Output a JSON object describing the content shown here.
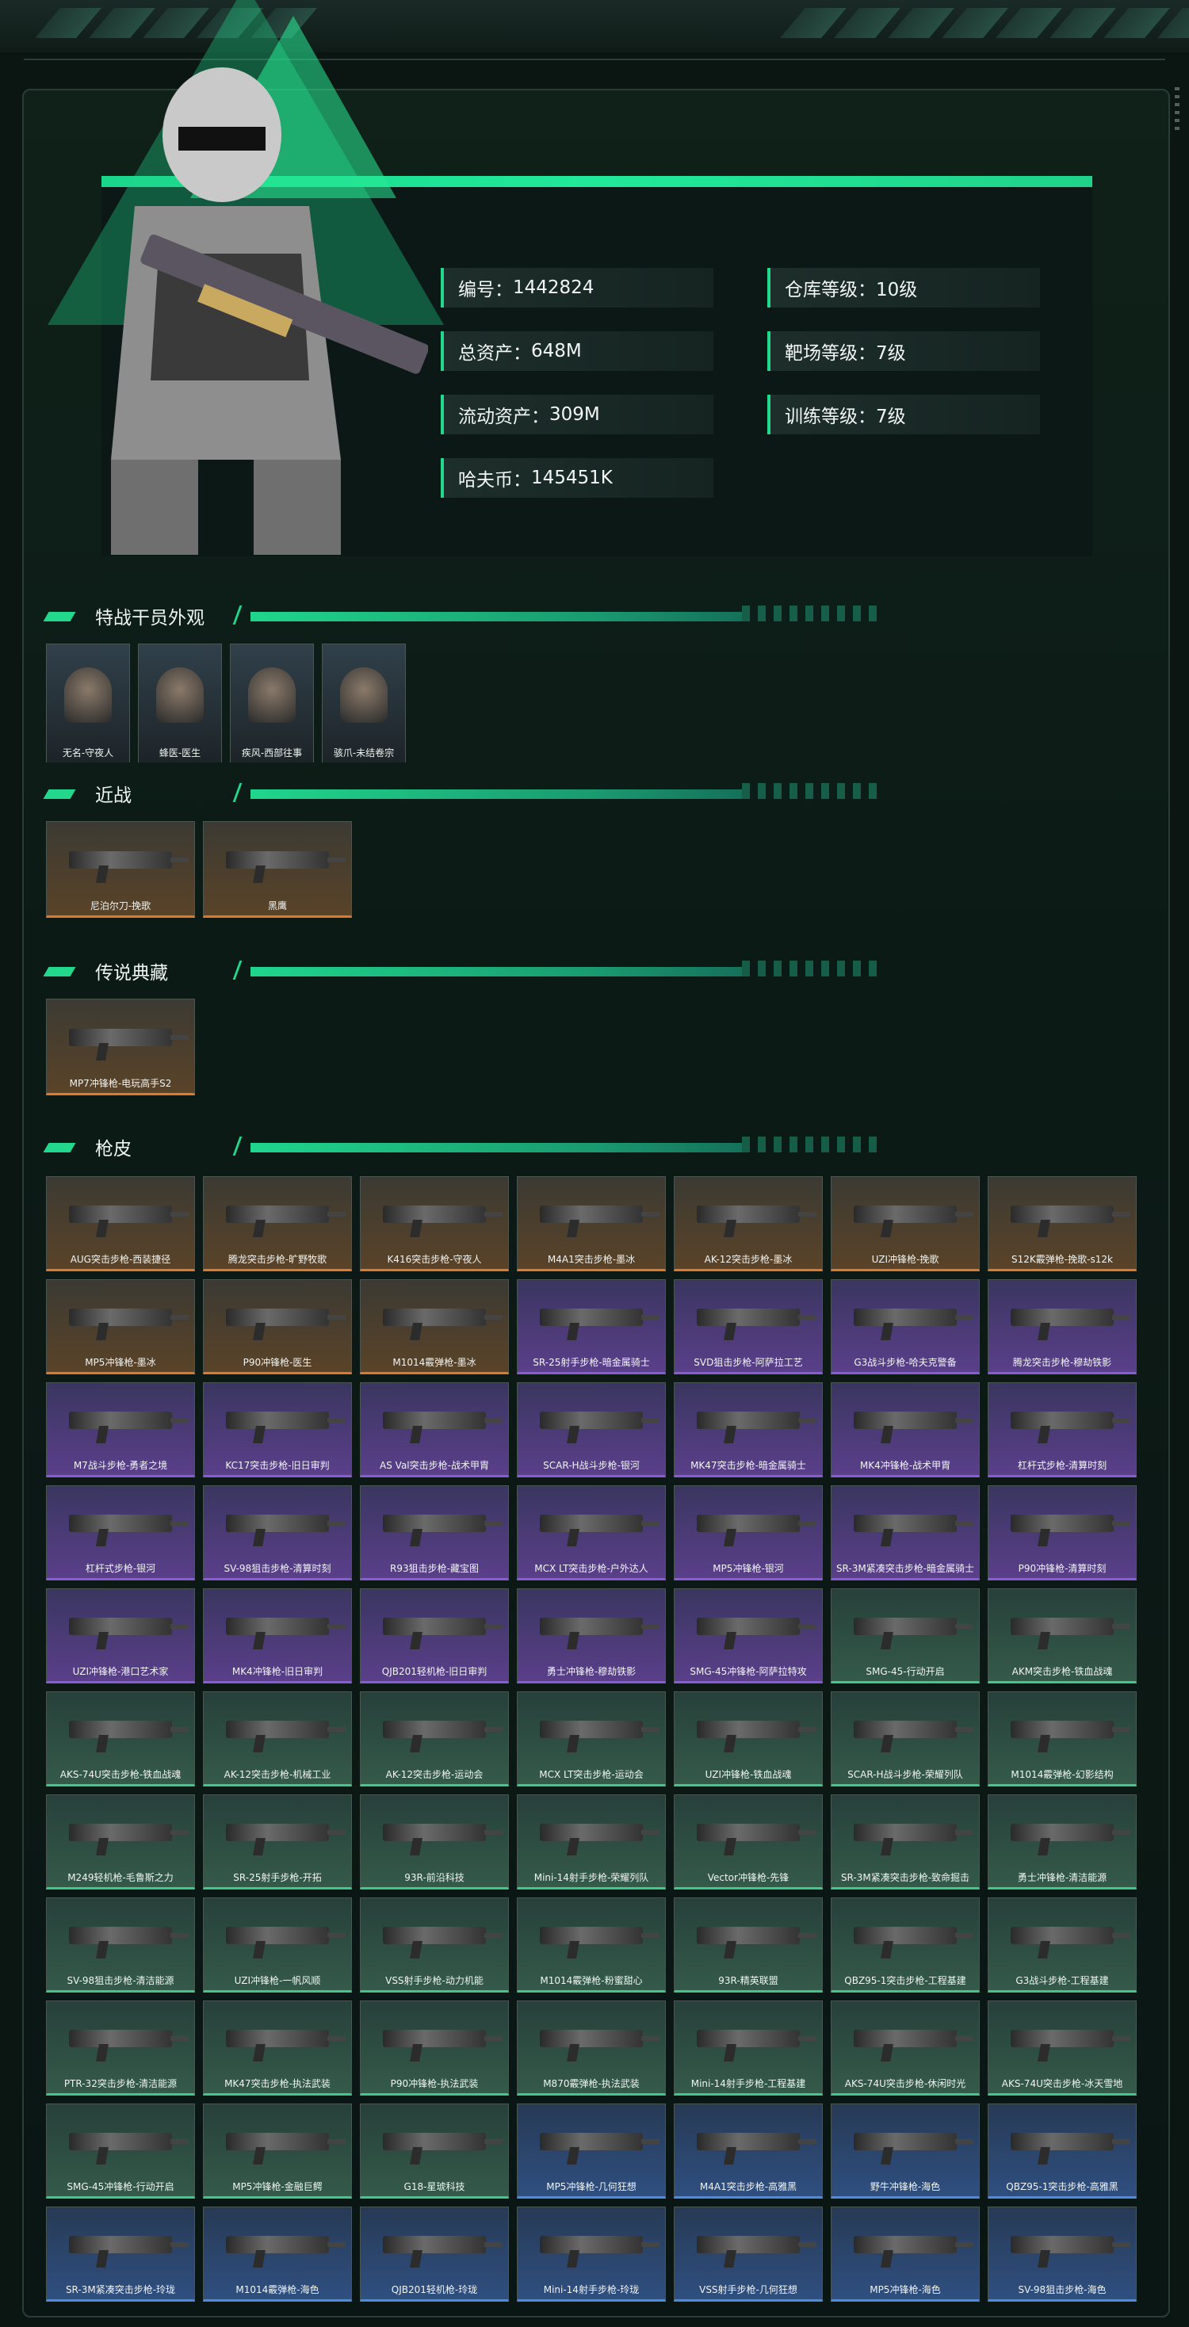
{
  "profile": {
    "id_label": "编号：",
    "id_value": "1442824",
    "total_label": "总资产：",
    "total_value": "648M",
    "liquid_label": "流动资产：",
    "liquid_value": "309M",
    "coin_label": "哈夫币：",
    "coin_value": "145451K",
    "warehouse_label": "仓库等级：",
    "warehouse_value": "10级",
    "range_label": "靶场等级：",
    "range_value": "7级",
    "training_label": "训练等级：",
    "training_value": "7级"
  },
  "sections": {
    "agents": "特战干员外观",
    "melee": "近战",
    "legend": "传说典藏",
    "skins": "枪皮"
  },
  "agents": [
    "无名-守夜人",
    "蜂医-医生",
    "疾风-西部往事",
    "骇爪-未结卷宗"
  ],
  "melee": [
    "尼泊尔刀-挽歌",
    "黑鹰"
  ],
  "legend": [
    "MP7冲锋枪-电玩高手S2"
  ],
  "skins": [
    {
      "name": "AUG突击步枪-西装捷径",
      "tier": "orange"
    },
    {
      "name": "腾龙突击步枪-旷野牧歌",
      "tier": "orange"
    },
    {
      "name": "K416突击步枪-守夜人",
      "tier": "orange"
    },
    {
      "name": "M4A1突击步枪-墨冰",
      "tier": "orange"
    },
    {
      "name": "AK-12突击步枪-墨冰",
      "tier": "orange"
    },
    {
      "name": "UZI冲锋枪-挽歌",
      "tier": "orange"
    },
    {
      "name": "S12K霰弹枪-挽歌-s12k",
      "tier": "orange"
    },
    {
      "name": "MP5冲锋枪-墨冰",
      "tier": "orange"
    },
    {
      "name": "P90冲锋枪-医生",
      "tier": "orange"
    },
    {
      "name": "M1014霰弹枪-墨冰",
      "tier": "orange"
    },
    {
      "name": "SR-25射手步枪-暗金属骑士",
      "tier": "purple"
    },
    {
      "name": "SVD狙击步枪-阿萨拉工艺",
      "tier": "purple"
    },
    {
      "name": "G3战斗步枪-哈夫克警备",
      "tier": "purple"
    },
    {
      "name": "腾龙突击步枪-穆劫铁影",
      "tier": "purple"
    },
    {
      "name": "M7战斗步枪-勇者之境",
      "tier": "purple"
    },
    {
      "name": "KC17突击步枪-旧日审判",
      "tier": "purple"
    },
    {
      "name": "AS Val突击步枪-战术甲胄",
      "tier": "purple"
    },
    {
      "name": "SCAR-H战斗步枪-银河",
      "tier": "purple"
    },
    {
      "name": "MK47突击步枪-暗金属骑士",
      "tier": "purple"
    },
    {
      "name": "MK4冲锋枪-战术甲胄",
      "tier": "purple"
    },
    {
      "name": "杠杆式步枪-清算时刻",
      "tier": "purple"
    },
    {
      "name": "杠杆式步枪-银河",
      "tier": "purple"
    },
    {
      "name": "SV-98狙击步枪-清算时刻",
      "tier": "purple"
    },
    {
      "name": "R93狙击步枪-藏宝图",
      "tier": "purple"
    },
    {
      "name": "MCX LT突击步枪-户外达人",
      "tier": "purple"
    },
    {
      "name": "MP5冲锋枪-银河",
      "tier": "purple"
    },
    {
      "name": "SR-3M紧凑突击步枪-暗金属骑士",
      "tier": "purple"
    },
    {
      "name": "P90冲锋枪-清算时刻",
      "tier": "purple"
    },
    {
      "name": "UZI冲锋枪-港口艺术家",
      "tier": "purple"
    },
    {
      "name": "MK4冲锋枪-旧日审判",
      "tier": "purple"
    },
    {
      "name": "QJB201轻机枪-旧日审判",
      "tier": "purple"
    },
    {
      "name": "勇士冲锋枪-穆劫铁影",
      "tier": "purple"
    },
    {
      "name": "SMG-45冲锋枪-阿萨拉特攻",
      "tier": "purple"
    },
    {
      "name": "SMG-45-行动开启",
      "tier": "green"
    },
    {
      "name": "AKM突击步枪-铁血战魂",
      "tier": "green"
    },
    {
      "name": "AKS-74U突击步枪-铁血战魂",
      "tier": "green"
    },
    {
      "name": "AK-12突击步枪-机械工业",
      "tier": "green"
    },
    {
      "name": "AK-12突击步枪-运动会",
      "tier": "green"
    },
    {
      "name": "MCX LT突击步枪-运动会",
      "tier": "green"
    },
    {
      "name": "UZI冲锋枪-铁血战魂",
      "tier": "green"
    },
    {
      "name": "SCAR-H战斗步枪-荣耀列队",
      "tier": "green"
    },
    {
      "name": "M1014霰弹枪-幻影结构",
      "tier": "green"
    },
    {
      "name": "M249轻机枪-毛鲁斯之力",
      "tier": "green"
    },
    {
      "name": "SR-25射手步枪-开拓",
      "tier": "green"
    },
    {
      "name": "93R-前沿科技",
      "tier": "green"
    },
    {
      "name": "Mini-14射手步枪-荣耀列队",
      "tier": "green"
    },
    {
      "name": "Vector冲锋枪-先锋",
      "tier": "green"
    },
    {
      "name": "SR-3M紧凑突击步枪-致命掘击",
      "tier": "green"
    },
    {
      "name": "勇士冲锋枪-清洁能源",
      "tier": "green"
    },
    {
      "name": "SV-98狙击步枪-清洁能源",
      "tier": "green"
    },
    {
      "name": "UZI冲锋枪-一帆风顺",
      "tier": "green"
    },
    {
      "name": "VSS射手步枪-动力机能",
      "tier": "green"
    },
    {
      "name": "M1014霰弹枪-粉蜜甜心",
      "tier": "green"
    },
    {
      "name": "93R-精英联盟",
      "tier": "green"
    },
    {
      "name": "QBZ95-1突击步枪-工程基建",
      "tier": "green"
    },
    {
      "name": "G3战斗步枪-工程基建",
      "tier": "green"
    },
    {
      "name": "PTR-32突击步枪-清洁能源",
      "tier": "green"
    },
    {
      "name": "MK47突击步枪-执法武装",
      "tier": "green"
    },
    {
      "name": "P90冲锋枪-执法武装",
      "tier": "green"
    },
    {
      "name": "M870霰弹枪-执法武装",
      "tier": "green"
    },
    {
      "name": "Mini-14射手步枪-工程基建",
      "tier": "green"
    },
    {
      "name": "AKS-74U突击步枪-休闲时光",
      "tier": "green"
    },
    {
      "name": "AKS-74U突击步枪-冰天雪地",
      "tier": "green"
    },
    {
      "name": "SMG-45冲锋枪-行动开启",
      "tier": "green"
    },
    {
      "name": "MP5冲锋枪-金融巨鳄",
      "tier": "green"
    },
    {
      "name": "G18-星琥科技",
      "tier": "green"
    },
    {
      "name": "MP5冲锋枪-几何狂想",
      "tier": "blue"
    },
    {
      "name": "M4A1突击步枪-高雅黑",
      "tier": "blue"
    },
    {
      "name": "野牛冲锋枪-海色",
      "tier": "blue"
    },
    {
      "name": "QBZ95-1突击步枪-高雅黑",
      "tier": "blue"
    },
    {
      "name": "SR-3M紧凑突击步枪-玲珑",
      "tier": "blue"
    },
    {
      "name": "M1014霰弹枪-海色",
      "tier": "blue"
    },
    {
      "name": "QJB201轻机枪-玲珑",
      "tier": "blue"
    },
    {
      "name": "Mini-14射手步枪-玲珑",
      "tier": "blue"
    },
    {
      "name": "VSS射手步枪-几何狂想",
      "tier": "blue"
    },
    {
      "name": "MP5冲锋枪-海色",
      "tier": "blue"
    },
    {
      "name": "SV-98狙击步枪-海色",
      "tier": "blue"
    }
  ],
  "colors": {
    "accent": "#22d88d",
    "orange": "#e07a2a",
    "purple": "#8a5ad8",
    "green": "#3ec98a",
    "blue": "#4a8ce0"
  }
}
